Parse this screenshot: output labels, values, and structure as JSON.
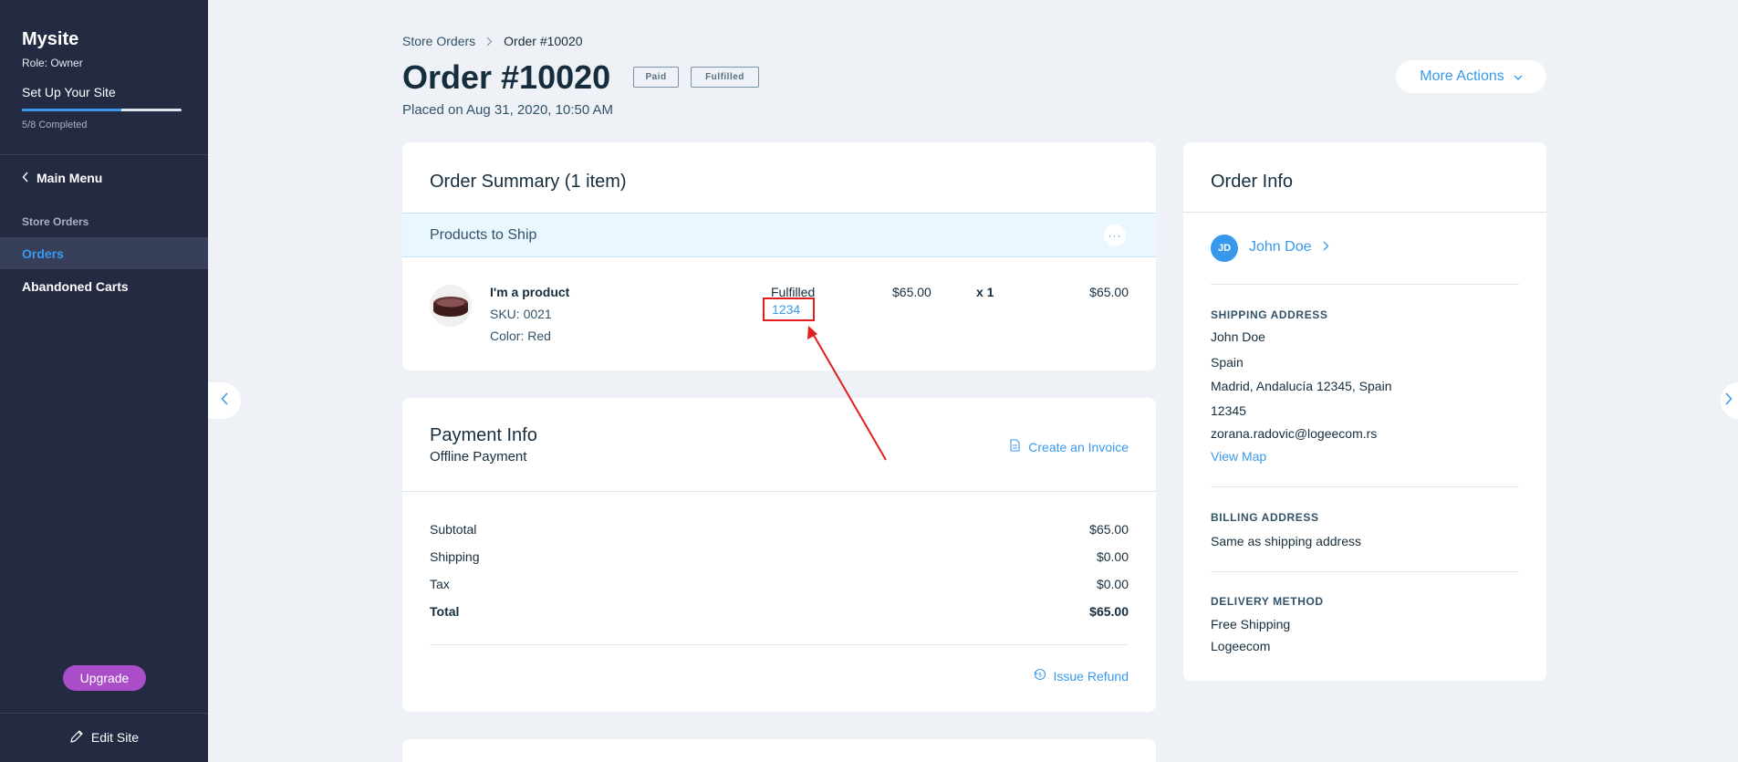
{
  "sidebar": {
    "site_name": "Mysite",
    "role": "Role: Owner",
    "setup_label": "Set Up Your Site",
    "setup_progress": 0.625,
    "completed_label": "5/8 Completed",
    "main_menu_label": "Main Menu",
    "section_label": "Store Orders",
    "items": [
      {
        "label": "Orders",
        "active": true
      },
      {
        "label": "Abandoned Carts",
        "active": false
      }
    ],
    "upgrade_label": "Upgrade",
    "edit_site_label": "Edit Site"
  },
  "breadcrumb": {
    "parent": "Store Orders",
    "current": "Order #10020"
  },
  "order": {
    "title": "Order #10020",
    "badges": [
      "Paid",
      "Fulfilled"
    ],
    "placed": "Placed on Aug 31, 2020, 10:50 AM",
    "more_actions": "More Actions"
  },
  "summary": {
    "title": "Order Summary (1 item)",
    "section_label": "Products to Ship",
    "dots": "···",
    "product": {
      "name": "I'm a product",
      "sku": "SKU: 0021",
      "color": "Color: Red",
      "status": "Fulfilled",
      "tracking": "1234",
      "price": "$65.00",
      "qty": "x 1",
      "total": "$65.00"
    }
  },
  "payment": {
    "title": "Payment Info",
    "subtitle": "Offline Payment",
    "invoice_label": "Create an Invoice",
    "rows": [
      {
        "label": "Subtotal",
        "value": "$65.00"
      },
      {
        "label": "Shipping",
        "value": "$0.00"
      },
      {
        "label": "Tax",
        "value": "$0.00"
      },
      {
        "label": "Total",
        "value": "$65.00"
      }
    ],
    "refund_label": "Issue Refund"
  },
  "info": {
    "title": "Order Info",
    "avatar_initials": "JD",
    "customer_name": "John Doe",
    "shipping_heading": "SHIPPING ADDRESS",
    "shipping_lines": [
      "John Doe",
      "Spain",
      "Madrid, Andalucía 12345, Spain",
      "12345",
      "zorana.radovic@logeecom.rs"
    ],
    "view_map": "View Map",
    "billing_heading": "BILLING ADDRESS",
    "billing_text": "Same as shipping address",
    "delivery_heading": "DELIVERY METHOD",
    "delivery_lines": [
      "Free Shipping",
      "Logeecom"
    ]
  },
  "colors": {
    "sidebar_bg": "#242a41",
    "accent": "#3899ec",
    "upgrade": "#aa4dc8",
    "annotation": "#e31e1e"
  },
  "icons": [
    "chevron-left-icon",
    "chevron-right-icon",
    "pencil-icon",
    "chevron-down-icon",
    "invoice-icon",
    "refund-icon",
    "more-dots-icon"
  ]
}
